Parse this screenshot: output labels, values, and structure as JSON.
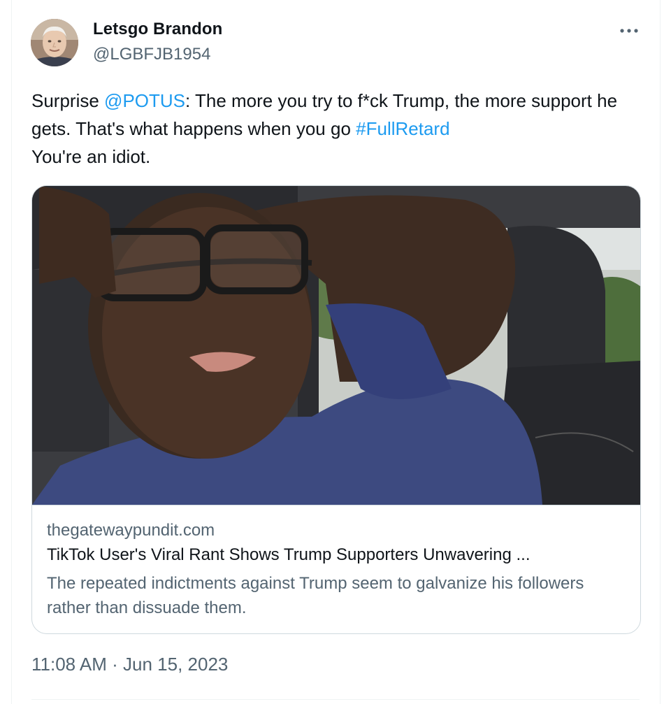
{
  "author": {
    "display_name": "Letsgo Brandon",
    "handle": "@LGBFJB1954",
    "avatar_icon": "profile-photo"
  },
  "more_icon": "more-horizontal-icon",
  "tweet": {
    "text_before_mention": "Surprise ",
    "mention": "@POTUS",
    "text_line_rest": ": The more you try to f*ck Trump, the more support he gets. That's what happens when you go ",
    "hashtag": "#FullRetard",
    "text_after_hashtag": "You're an idiot."
  },
  "link_card": {
    "domain": "thegatewaypundit.com",
    "title": "TikTok User's Viral Rant Shows Trump Supporters Unwavering ...",
    "description": "The repeated indictments against Trump seem to galvanize his followers rather than dissuade them."
  },
  "timestamp": "11:08 AM · Jun 15, 2023",
  "colors": {
    "link": "#1d9bf0",
    "secondary_text": "#536471",
    "primary_text": "#0f1419",
    "border": "#cfd9de"
  }
}
